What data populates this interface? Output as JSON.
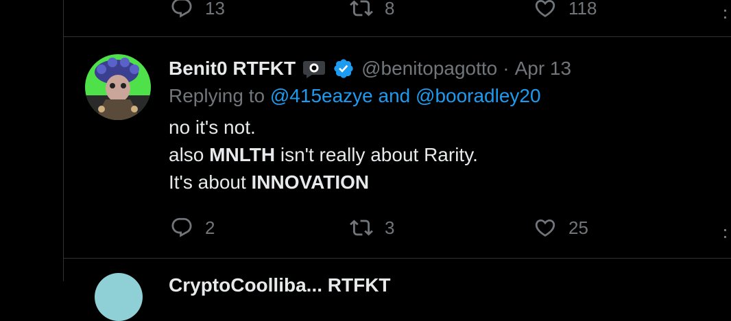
{
  "prev_tweet": {
    "replies": "13",
    "retweets": "8",
    "likes": "118"
  },
  "tweet": {
    "name": "Benit0 RTFKT",
    "handle": "@benitopagotto",
    "separator": "·",
    "date": "Apr 13",
    "replying_prefix": "Replying to",
    "mention1": "@415eazye",
    "replying_and": "and",
    "mention2": "@booradley20",
    "line1": "no it's not.",
    "line2_pre": "also ",
    "line2_bold": "MNLTH",
    "line2_post": " isn't really about Rarity.",
    "line3_pre": "It's about ",
    "line3_bold": "INNOVATION",
    "replies": "2",
    "retweets": "3",
    "likes": "25"
  },
  "next_tweet": {
    "name_partial": "CryptoCoolliba... RTFKT"
  },
  "icons": {
    "reply": "reply-icon",
    "retweet": "retweet-icon",
    "like": "heart-icon",
    "verified": "verified-badge-icon",
    "affiliate": "affiliate-badge-icon"
  },
  "colors": {
    "background": "#000000",
    "text": "#e7e9ea",
    "secondary": "#71767b",
    "link": "#1d9bf0",
    "divider": "#2f3336"
  }
}
